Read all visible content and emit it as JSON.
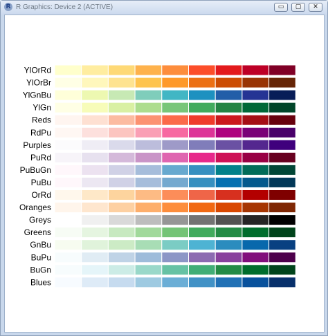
{
  "window": {
    "title": "R Graphics: Device 2 (ACTIVE)",
    "logo_text": "R",
    "buttons": {
      "minimize": "▭",
      "maximize": "▢",
      "close": "✕"
    }
  },
  "chart_data": {
    "type": "heatmap",
    "title": "",
    "palettes": [
      {
        "name": "YlOrRd",
        "colors": [
          "#FFFFCC",
          "#FFEDA0",
          "#FED976",
          "#FEB24C",
          "#FD8D3C",
          "#FC4E2A",
          "#E31A1C",
          "#BD0026",
          "#800026"
        ]
      },
      {
        "name": "YlOrBr",
        "colors": [
          "#FFFFE5",
          "#FFF7BC",
          "#FEE391",
          "#FEC44F",
          "#FE9929",
          "#EC7014",
          "#CC4C02",
          "#993404",
          "#662506"
        ]
      },
      {
        "name": "YlGnBu",
        "colors": [
          "#FFFFD9",
          "#EDF8B1",
          "#C7E9B4",
          "#7FCDBB",
          "#41B6C4",
          "#1D91C0",
          "#225EA8",
          "#253494",
          "#081D58"
        ]
      },
      {
        "name": "YlGn",
        "colors": [
          "#FFFFE5",
          "#F7FCB9",
          "#D9F0A3",
          "#ADDD8E",
          "#78C679",
          "#41AB5D",
          "#238443",
          "#006837",
          "#004529"
        ]
      },
      {
        "name": "Reds",
        "colors": [
          "#FFF5F0",
          "#FEE0D2",
          "#FCBBA1",
          "#FC9272",
          "#FB6A4A",
          "#EF3B2C",
          "#CB181D",
          "#A50F15",
          "#67000D"
        ]
      },
      {
        "name": "RdPu",
        "colors": [
          "#FFF7F3",
          "#FDE0DD",
          "#FCC5C0",
          "#FA9FB5",
          "#F768A1",
          "#DD3497",
          "#AE017E",
          "#7A0177",
          "#49006A"
        ]
      },
      {
        "name": "Purples",
        "colors": [
          "#FCFBFD",
          "#EFEDF5",
          "#DADAEB",
          "#BCBDDC",
          "#9E9AC8",
          "#807DBA",
          "#6A51A3",
          "#54278F",
          "#3F007D"
        ]
      },
      {
        "name": "PuRd",
        "colors": [
          "#F7F4F9",
          "#E7E1EF",
          "#D4B9DA",
          "#C994C7",
          "#DF65B0",
          "#E7298A",
          "#CE1256",
          "#980043",
          "#67001F"
        ]
      },
      {
        "name": "PuBuGn",
        "colors": [
          "#FFF7FB",
          "#ECE2F0",
          "#D0D1E6",
          "#A6BDDB",
          "#67A9CF",
          "#3690C0",
          "#02818A",
          "#016C59",
          "#014636"
        ]
      },
      {
        "name": "PuBu",
        "colors": [
          "#FFF7FB",
          "#ECE7F2",
          "#D0D1E6",
          "#A6BDDB",
          "#74A9CF",
          "#3690C0",
          "#0570B0",
          "#045A8D",
          "#023858"
        ]
      },
      {
        "name": "OrRd",
        "colors": [
          "#FFF7EC",
          "#FEE8C8",
          "#FDD49E",
          "#FDBB84",
          "#FC8D59",
          "#EF6548",
          "#D7301F",
          "#B30000",
          "#7F0000"
        ]
      },
      {
        "name": "Oranges",
        "colors": [
          "#FFF5EB",
          "#FEE6CE",
          "#FDD0A2",
          "#FDAE6B",
          "#FD8D3C",
          "#F16913",
          "#D94801",
          "#A63603",
          "#7F2704"
        ]
      },
      {
        "name": "Greys",
        "colors": [
          "#FFFFFF",
          "#F0F0F0",
          "#D9D9D9",
          "#BDBDBD",
          "#969696",
          "#737373",
          "#525252",
          "#252525",
          "#000000"
        ]
      },
      {
        "name": "Greens",
        "colors": [
          "#F7FCF5",
          "#E5F5E0",
          "#C7E9C0",
          "#A1D99B",
          "#74C476",
          "#41AB5D",
          "#238B45",
          "#006D2C",
          "#00441B"
        ]
      },
      {
        "name": "GnBu",
        "colors": [
          "#F7FCF0",
          "#E0F3DB",
          "#CCEBC5",
          "#A8DDB5",
          "#7BCCC4",
          "#4EB3D3",
          "#2B8CBE",
          "#0868AC",
          "#084081"
        ]
      },
      {
        "name": "BuPu",
        "colors": [
          "#F7FCFD",
          "#E0ECF4",
          "#BFD3E6",
          "#9EBCDA",
          "#8C96C6",
          "#8C6BB1",
          "#88419D",
          "#810F7C",
          "#4D004B"
        ]
      },
      {
        "name": "BuGn",
        "colors": [
          "#F7FCFD",
          "#E5F5F9",
          "#CCECE6",
          "#99D8C9",
          "#66C2A4",
          "#41AE76",
          "#238B45",
          "#006D2C",
          "#00441B"
        ]
      },
      {
        "name": "Blues",
        "colors": [
          "#F7FBFF",
          "#DEEBF7",
          "#C6DBEF",
          "#9ECAE1",
          "#6BAED6",
          "#4292C6",
          "#2171B5",
          "#08519C",
          "#08306B"
        ]
      }
    ]
  }
}
